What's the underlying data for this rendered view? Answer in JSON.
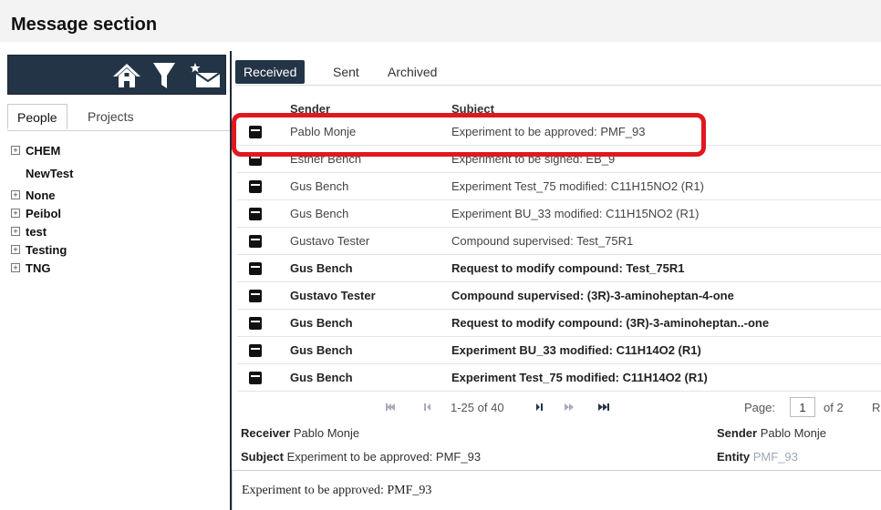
{
  "page": {
    "title": "Message section"
  },
  "toolbar": {
    "icons": [
      "home-icon",
      "filter-icon",
      "new-message-icon"
    ]
  },
  "left_tabs": [
    {
      "label": "People",
      "active": true
    },
    {
      "label": "Projects",
      "active": false
    }
  ],
  "tree": [
    {
      "label": "CHEM",
      "expandable": true
    },
    {
      "label": "NewTest",
      "expandable": false
    },
    {
      "label": "None",
      "expandable": true
    },
    {
      "label": "Peibol",
      "expandable": true
    },
    {
      "label": "test",
      "expandable": true
    },
    {
      "label": "Testing",
      "expandable": true
    },
    {
      "label": "TNG",
      "expandable": true
    }
  ],
  "right_tabs": [
    {
      "label": "Received",
      "active": true
    },
    {
      "label": "Sent",
      "active": false
    },
    {
      "label": "Archived",
      "active": false
    }
  ],
  "table": {
    "headers": {
      "sender": "Sender",
      "subject": "Subject"
    },
    "rows": [
      {
        "sender": "Pablo Monje",
        "subject": "Experiment to be approved: PMF_93",
        "unread": false,
        "highlighted": true
      },
      {
        "sender": "Esther Bench",
        "subject": "Experiment to be signed: EB_9",
        "unread": false
      },
      {
        "sender": "Gus Bench",
        "subject": "Experiment Test_75 modified: C11H15NO2 (R1)",
        "unread": false
      },
      {
        "sender": "Gus Bench",
        "subject": "Experiment BU_33 modified: C11H15NO2 (R1)",
        "unread": false
      },
      {
        "sender": "Gustavo Tester",
        "subject": "Compound supervised: Test_75R1",
        "unread": false
      },
      {
        "sender": "Gus Bench",
        "subject": "Request to modify compound: Test_75R1",
        "unread": true
      },
      {
        "sender": "Gustavo Tester",
        "subject": "Compound supervised: (3R)-3-aminoheptan-4-one",
        "unread": true
      },
      {
        "sender": "Gus Bench",
        "subject": "Request to modify compound: (3R)-3-aminoheptan..-one",
        "unread": true
      },
      {
        "sender": "Gus Bench",
        "subject": "Experiment BU_33 modified: C11H14O2 (R1)",
        "unread": true
      },
      {
        "sender": "Gus Bench",
        "subject": "Experiment Test_75 modified: C11H14O2 (R1)",
        "unread": true
      }
    ]
  },
  "pager": {
    "range": "1-25 of 40",
    "page_label": "Page:",
    "page_value": "1",
    "of_pages": "of 2",
    "extra": "R"
  },
  "detail": {
    "receiver_label": "Receiver",
    "receiver_value": "Pablo Monje",
    "sender_label": "Sender",
    "sender_value": "Pablo Monje",
    "subject_label": "Subject",
    "subject_value": "Experiment to be approved: PMF_93",
    "entity_label": "Entity",
    "entity_value": "PMF_93"
  },
  "message_body": "Experiment to be approved: PMF_93",
  "colors": {
    "toolbar_bg": "#243447",
    "highlight": "#e0181f",
    "entity_link": "#9aa8b6"
  }
}
